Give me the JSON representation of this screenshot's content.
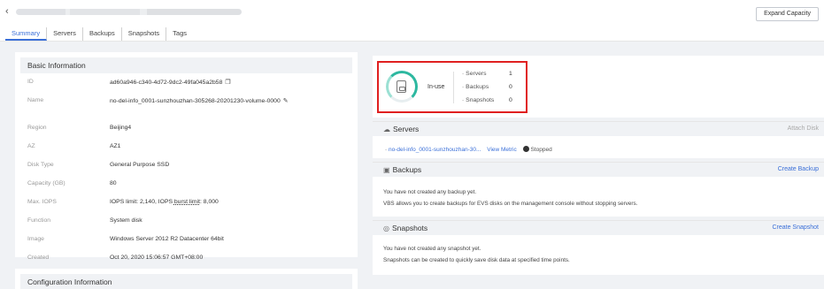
{
  "header": {
    "expand_label": "Expand Capacity"
  },
  "tabs": [
    {
      "label": "Summary"
    },
    {
      "label": "Servers"
    },
    {
      "label": "Backups"
    },
    {
      "label": "Snapshots"
    },
    {
      "label": "Tags"
    }
  ],
  "basic_info": {
    "title": "Basic Information",
    "rows": [
      {
        "label": "ID",
        "value": "ad60a946-c340-4d72-9dc2-49fa045a2b58"
      },
      {
        "label": "Name",
        "value": "no-del-info_0001-sunzhouzhan-305268-20201230-volume-0000"
      },
      {
        "label": "Region",
        "value": "Beijing4"
      },
      {
        "label": "AZ",
        "value": "AZ1"
      },
      {
        "label": "Disk Type",
        "value": "General Purpose SSD"
      },
      {
        "label": "Capacity (GB)",
        "value": "80"
      },
      {
        "label": "Max. IOPS",
        "value_a": "IOPS limit: 2,140, IOPS ",
        "value_b": "burst limit",
        "value_c": ": 8,000"
      },
      {
        "label": "Function",
        "value": "System disk"
      },
      {
        "label": "Image",
        "value": "Windows Server 2012 R2 Datacenter 64bit"
      },
      {
        "label": "Created",
        "value": "Oct 20, 2020 15:06:57 GMT+08:00"
      }
    ]
  },
  "config_info": {
    "title": "Configuration Information"
  },
  "status": {
    "label": "In-use",
    "counts": [
      {
        "key": "Servers",
        "value": "1"
      },
      {
        "key": "Backups",
        "value": "0"
      },
      {
        "key": "Snapshots",
        "value": "0"
      }
    ]
  },
  "servers": {
    "title": "Servers",
    "action": "Attach Disk",
    "server_name": "no-del-info_0001-sunzhouzhan-30...",
    "view_metric": "View Metric",
    "state": "Stopped"
  },
  "backups": {
    "title": "Backups",
    "action": "Create Backup",
    "line1": "You have not created any backup yet.",
    "line2": "VBS allows you to create backups for EVS disks on the management console without stopping servers."
  },
  "snapshots": {
    "title": "Snapshots",
    "action": "Create Snapshot",
    "line1": "You have not created any snapshot yet.",
    "line2": "Snapshots can be created to quickly save disk data at specified time points."
  },
  "colors": {
    "accent": "#3a6fd8",
    "status_ring": "#2db8a0",
    "highlight": "#e02020"
  }
}
